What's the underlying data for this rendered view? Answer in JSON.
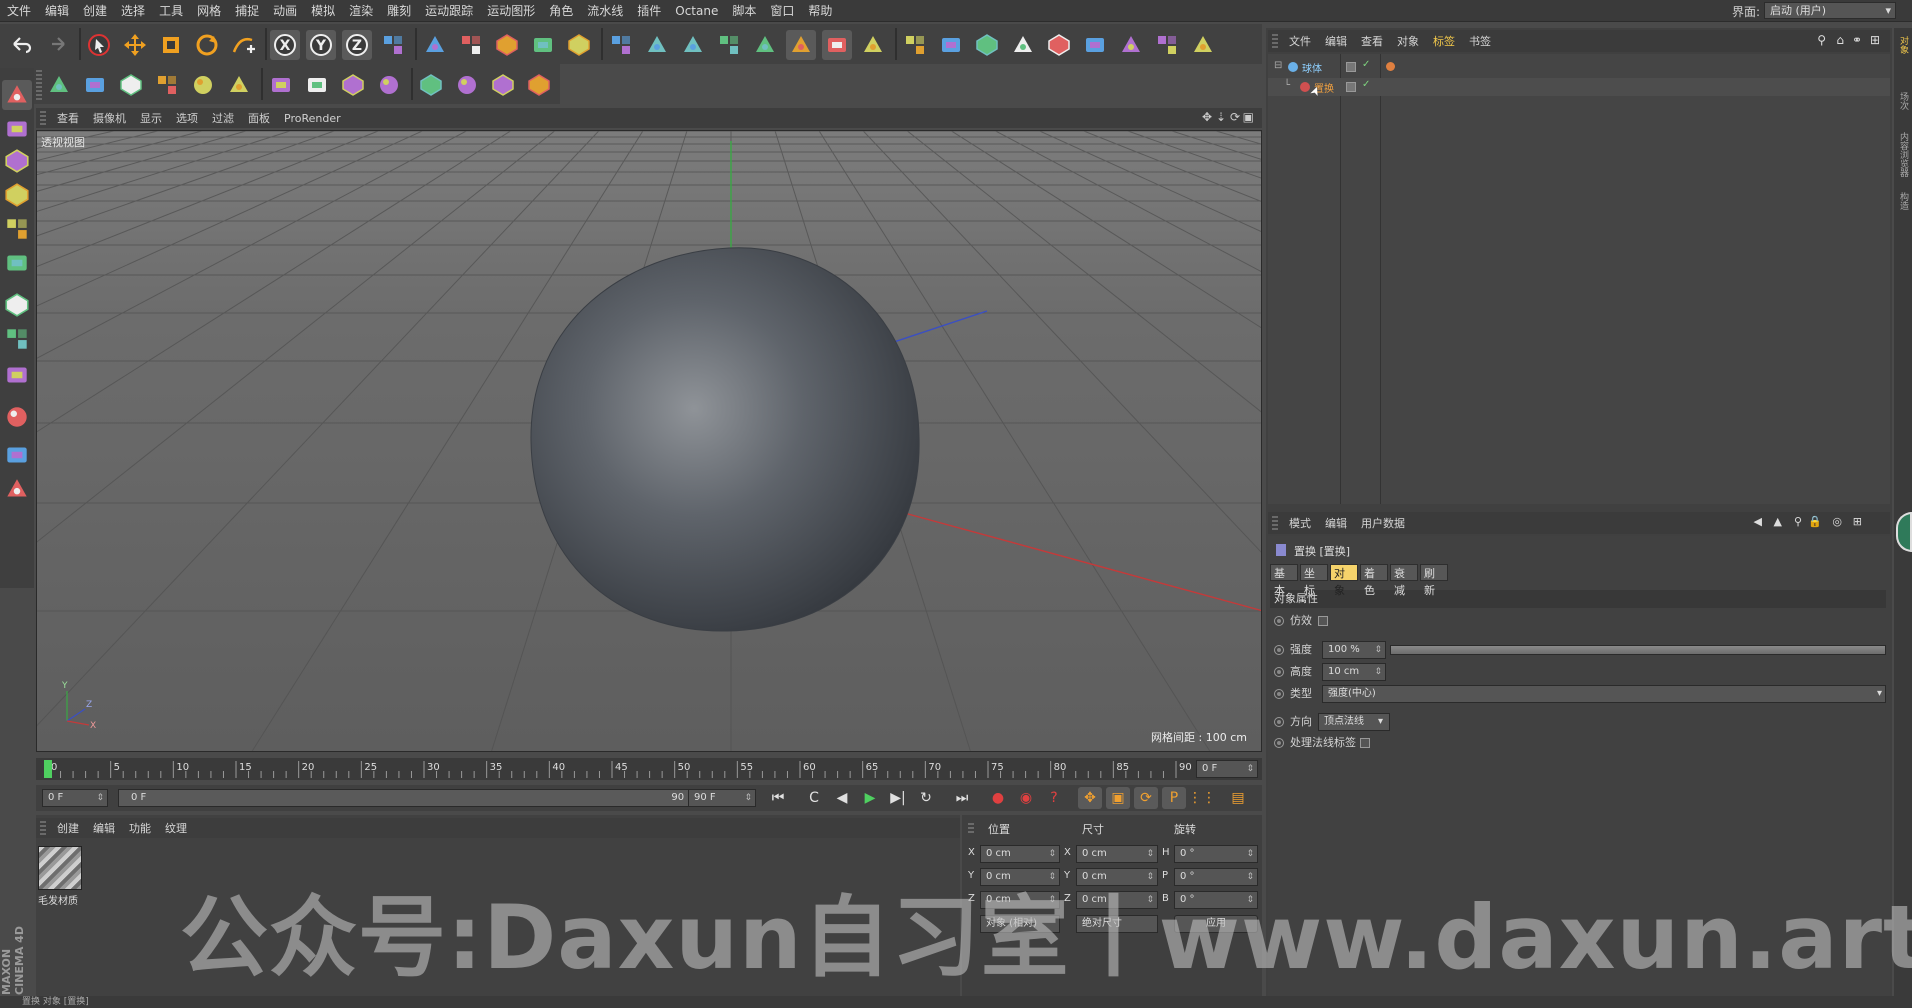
{
  "menubar": {
    "items": [
      "文件",
      "编辑",
      "创建",
      "选择",
      "工具",
      "网格",
      "捕捉",
      "动画",
      "模拟",
      "渲染",
      "雕刻",
      "运动跟踪",
      "运动图形",
      "角色",
      "流水线",
      "插件",
      "Octane",
      "脚本",
      "窗口",
      "帮助"
    ],
    "layout_label": "界面:",
    "layout_value": "启动 (用户)"
  },
  "toolbar_icons": {
    "row1": [
      "undo-icon",
      "redo-icon",
      "live-select-icon",
      "move-icon",
      "scale-icon",
      "rotate-icon",
      "add-object-icon",
      "x-axis-lock-icon",
      "y-axis-lock-icon",
      "z-axis-lock-icon",
      "coordinate-system-icon",
      "render-view-icon",
      "render-picture-viewer-icon",
      "render-settings-icon",
      "edit-render-settings-icon",
      "gear-icon",
      "cube-primitive-icon",
      "pen-spline-icon",
      "subdivision-surface-icon",
      "array-cloner-icon",
      "deformer-icon",
      "floor-scene-icon",
      "camera-icon",
      "light-icon",
      "xpresso-icon",
      "layers-icon",
      "sphere-materials-icon",
      "explode-icon",
      "octane-icon",
      "heart-icon",
      "paint-icon",
      "timeline-icon",
      "octane-render-icon"
    ],
    "row2": [
      "mograph-cloner-icon",
      "mograph-fracture-icon",
      "mograph-effector-icon",
      "text-icon",
      "tracer-icon",
      "spline-mask-icon",
      "grid-snap-icon",
      "polygon-tools-icon",
      "sweep-icon",
      "grid-array-icon",
      "bend-icon",
      "sculpt-icon",
      "world-icon",
      "globe-icon"
    ]
  },
  "viewport": {
    "menu": [
      "查看",
      "摄像机",
      "显示",
      "选项",
      "过滤",
      "面板",
      "ProRender"
    ],
    "label": "透视视图",
    "grid_distance": "网格间距 : 100 cm",
    "axis_labels": {
      "y": "Y",
      "z": "Z",
      "x": "X"
    }
  },
  "timeline": {
    "ticks": [
      "0",
      "5",
      "10",
      "15",
      "20",
      "25",
      "30",
      "35",
      "40",
      "45",
      "50",
      "55",
      "60",
      "65",
      "70",
      "75",
      "80",
      "85",
      "90"
    ],
    "current_frame_field": "0 F"
  },
  "transport": {
    "start_field": "0 F",
    "range_start": "0 F",
    "range_end": "90 F",
    "end_field": "90 F"
  },
  "materials": {
    "menu": [
      "创建",
      "编辑",
      "功能",
      "纹理"
    ],
    "items": [
      {
        "name": "毛发材质"
      }
    ]
  },
  "coords": {
    "headers": [
      "位置",
      "尺寸",
      "旋转"
    ],
    "rows": [
      {
        "axis": "X",
        "pos": "0 cm",
        "size_axis": "X",
        "size": "0 cm",
        "rot_axis": "H",
        "rot": "0 °"
      },
      {
        "axis": "Y",
        "pos": "0 cm",
        "size_axis": "Y",
        "size": "0 cm",
        "rot_axis": "P",
        "rot": "0 °"
      },
      {
        "axis": "Z",
        "pos": "0 cm",
        "size_axis": "Z",
        "size": "0 cm",
        "rot_axis": "B",
        "rot": "0 °"
      }
    ],
    "mode_select": "对象 (相对)",
    "size_select": "绝对尺寸",
    "apply_label": "应用"
  },
  "object_manager": {
    "menu": [
      "文件",
      "编辑",
      "查看",
      "对象",
      "标签",
      "书签"
    ],
    "active_menu": "标签",
    "objects": [
      {
        "name": "球体"
      },
      {
        "name": "置换"
      }
    ]
  },
  "attributes": {
    "menu": [
      "模式",
      "编辑",
      "用户数据"
    ],
    "title": "置换 [置换]",
    "tabs": [
      "基本",
      "坐标",
      "对象",
      "着色",
      "衰减",
      "刷新"
    ],
    "active_tab": "对象",
    "section": "对象属性",
    "props": {
      "emulation": "仿效",
      "strength_label": "强度",
      "strength_value": "100 %",
      "height_label": "高度",
      "height_value": "10 cm",
      "type_label": "类型",
      "type_value": "强度(中心)",
      "direction_label": "方向",
      "direction_value": "顶点法线",
      "normal_tag_label": "处理法线标签"
    },
    "strength_fraction": 1.0
  },
  "right_side_tabs": [
    "对象",
    "场次",
    "内容浏览器",
    "构造"
  ],
  "statusbar": {
    "text": "置换 对象 [置换]"
  },
  "brand": {
    "text": "MAXON CINEMA 4D"
  },
  "watermark": {
    "text": "公众号:Daxun自习室丨www.daxun.art"
  },
  "colors": {
    "accent_active": "#f5d36b",
    "axis_x": "#c43a3a",
    "axis_y": "#3aa845",
    "axis_z": "#3a4fc4",
    "object_name_active": "#f0a040"
  }
}
